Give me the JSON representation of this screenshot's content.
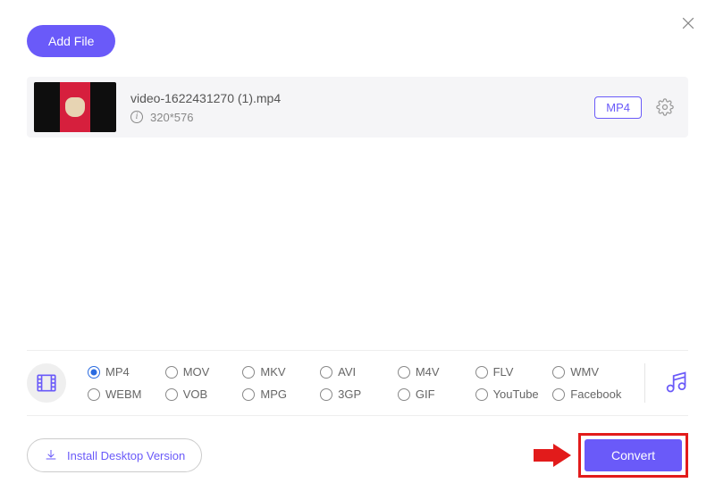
{
  "header": {
    "add_file_label": "Add File"
  },
  "file": {
    "name": "video-1622431270 (1).mp4",
    "dimensions": "320*576",
    "badge": "MP4"
  },
  "formats": {
    "row1": [
      "MP4",
      "MOV",
      "MKV",
      "AVI",
      "M4V",
      "FLV",
      "WMV"
    ],
    "row2": [
      "WEBM",
      "VOB",
      "MPG",
      "3GP",
      "GIF",
      "YouTube",
      "Facebook"
    ],
    "selected": "MP4"
  },
  "footer": {
    "install_label": "Install Desktop Version",
    "convert_label": "Convert"
  }
}
